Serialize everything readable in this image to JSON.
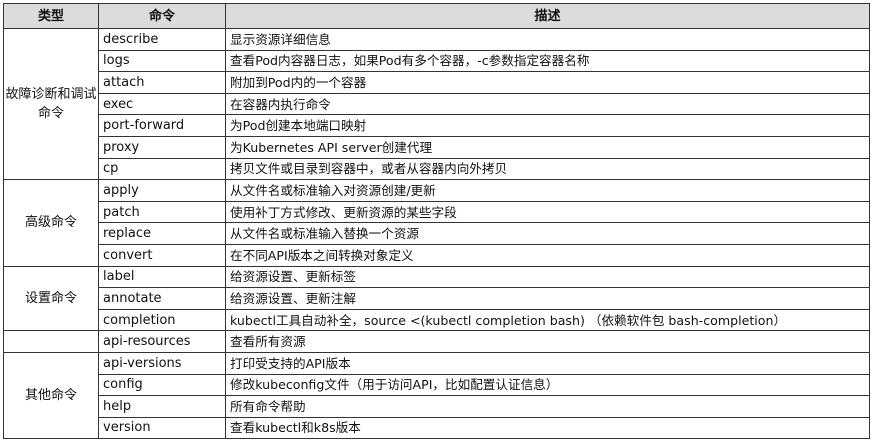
{
  "table": {
    "headers": {
      "type": "类型",
      "command": "命令",
      "description": "描述"
    },
    "groups": [
      {
        "category": "故障诊断和调试命令",
        "rows": [
          {
            "cmd": "describe",
            "desc": "显示资源详细信息"
          },
          {
            "cmd": "logs",
            "desc": "查看Pod内容器日志，如果Pod有多个容器，-c参数指定容器名称"
          },
          {
            "cmd": "attach",
            "desc": "附加到Pod内的一个容器"
          },
          {
            "cmd": "exec",
            "desc": "在容器内执行命令"
          },
          {
            "cmd": "port-forward",
            "desc": "为Pod创建本地端口映射"
          },
          {
            "cmd": "proxy",
            "desc": "为Kubernetes API server创建代理"
          },
          {
            "cmd": "cp",
            "desc": "拷贝文件或目录到容器中，或者从容器内向外拷贝"
          }
        ]
      },
      {
        "category": "高级命令",
        "rows": [
          {
            "cmd": "apply",
            "desc": "从文件名或标准输入对资源创建/更新"
          },
          {
            "cmd": "patch",
            "desc": "使用补丁方式修改、更新资源的某些字段"
          },
          {
            "cmd": "replace",
            "desc": "从文件名或标准输入替换一个资源"
          },
          {
            "cmd": "convert",
            "desc": "在不同API版本之间转换对象定义"
          }
        ]
      },
      {
        "category": "设置命令",
        "rows": [
          {
            "cmd": "label",
            "desc": "给资源设置、更新标签"
          },
          {
            "cmd": "annotate",
            "desc": "给资源设置、更新注解"
          },
          {
            "cmd": "completion",
            "desc": "kubectl工具自动补全，source <(kubectl completion bash) （依赖软件包 bash-completion）"
          }
        ]
      },
      {
        "category": "",
        "rows": [
          {
            "cmd": "api-resources",
            "desc": "查看所有资源"
          }
        ]
      },
      {
        "category": "其他命令",
        "rows": [
          {
            "cmd": "api-versions",
            "desc": "打印受支持的API版本"
          },
          {
            "cmd": "config",
            "desc": "修改kubeconfig文件（用于访问API，比如配置认证信息）"
          },
          {
            "cmd": "help",
            "desc": "所有命令帮助"
          },
          {
            "cmd": "version",
            "desc": "查看kubectl和k8s版本"
          }
        ]
      }
    ]
  }
}
